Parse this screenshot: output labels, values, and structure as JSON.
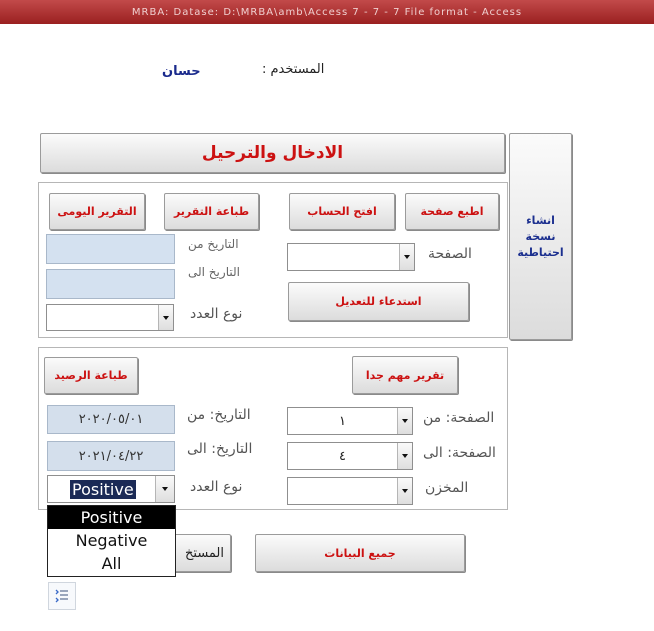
{
  "window": {
    "title": "MRBA: Datase: D:\\MRBA\\amb\\Access 7 - 7 - 7 File format - Access"
  },
  "user": {
    "label": "المستخدم :",
    "name": "حسان"
  },
  "header_button": "الادخال والترحيل",
  "backup_button": "انشاء نسخة احتياطية",
  "section1": {
    "print_page": "اطبع صفحة",
    "open_account": "افتح الحساب",
    "print_report": "طباعة التقرير",
    "daily_report": "التقرير اليومى",
    "page_label": "الصفحة",
    "recall_edit": "استدعاء للتعديل",
    "date_from_label": "التاريخ من",
    "date_to_label": "التاريخ الى",
    "number_type_label": "نوع العدد",
    "page_value": "",
    "date_from_value": "",
    "date_to_value": "",
    "number_type_value": ""
  },
  "section2": {
    "very_important_report": "تقرير مهم جدا",
    "print_balance": "طباعة الرصيد",
    "page_from_label": "الصفحة: من",
    "page_to_label": "الصفحة: الى",
    "warehouse_label": "المخزن",
    "date_from_label": "التاريخ: من",
    "date_to_label": "التاريخ: الى",
    "number_type_label": "نوع العدد",
    "page_from_value": "١",
    "page_to_value": "٤",
    "warehouse_value": "",
    "date_from_value": "٢٠٢٠/٠٥/٠١",
    "date_to_value": "٢٠٢١/٠٤/٢٢",
    "number_type_value": "Positive"
  },
  "dropdown_options": [
    "Positive",
    "Negative",
    "All"
  ],
  "all_data_button": "جميع البيانات",
  "users_button": "المستخ",
  "icons": {
    "backup": "none",
    "bottom_icon": "sort-list-icon"
  }
}
